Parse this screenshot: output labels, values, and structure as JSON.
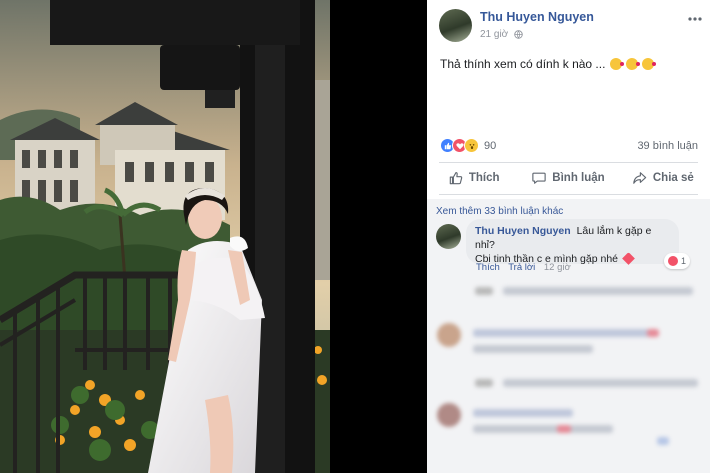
{
  "post": {
    "author": "Thu Huyen Nguyen",
    "time": "21 giờ",
    "text": "Thả thính xem có dính k nào ...",
    "reactions_count": "90",
    "comments_count": "39 bình luận"
  },
  "actions": {
    "like": "Thích",
    "comment": "Bình luận",
    "share": "Chia sẻ"
  },
  "comments": {
    "view_more": "Xem thêm 33 bình luận khác",
    "first": {
      "author": "Thu Huyen Nguyen",
      "line1": "Lâu lắm k gặp e nhỉ?",
      "line2": "Cbi tinh thần c e mình gặp nhé",
      "reaction_count": "1",
      "like_label": "Thích",
      "reply_label": "Trả lời",
      "time": "12 giờ"
    }
  },
  "colors": {
    "link": "#365899",
    "like": "#4080ff",
    "love": "#f25268",
    "wow": "#f7c53b"
  },
  "icons": [
    "more-icon",
    "globe-icon",
    "like-icon",
    "comment-icon",
    "share-icon"
  ]
}
